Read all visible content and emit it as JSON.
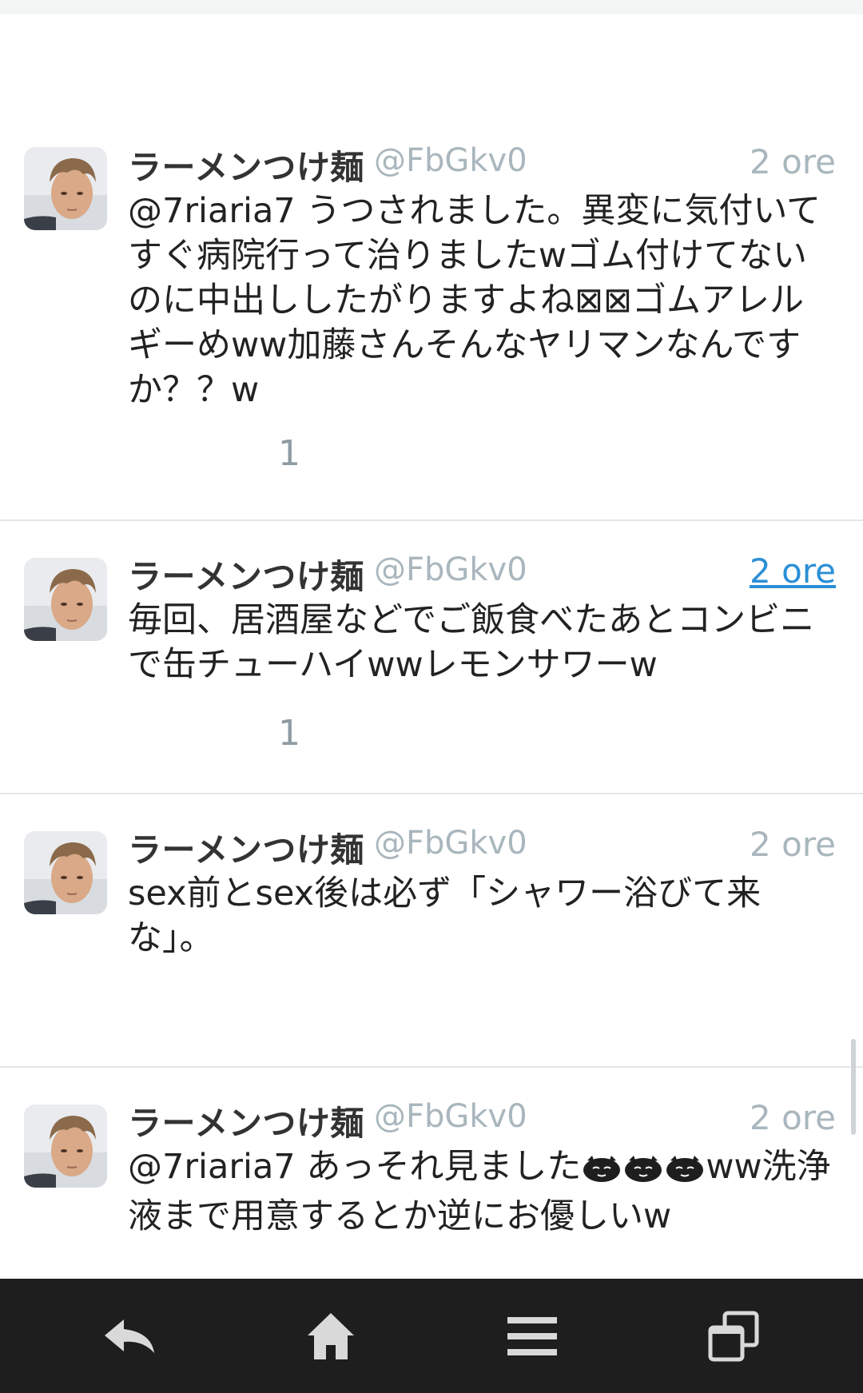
{
  "tweets": [
    {
      "name": "ラーメンつけ麺",
      "handle": "@FbGkv0",
      "time": "2 ore",
      "time_link": false,
      "text": "@7riaria7 うつされました。異変に気付いてすぐ病院行って治りましたwゴム付けてないのに中出ししたがりますよね⊠⊠ゴムアレルギーめww加藤さんそんなヤリマンなんですか？？w",
      "count": "1"
    },
    {
      "name": "ラーメンつけ麺",
      "handle": "@FbGkv0",
      "time": "2 ore",
      "time_link": true,
      "text": "毎回、居酒屋などでご飯食べたあとコンビニで缶チューハイwwレモンサワーw",
      "count": "1"
    },
    {
      "name": "ラーメンつけ麺",
      "handle": "@FbGkv0",
      "time": "2 ore",
      "time_link": false,
      "text": "sex前とsex後は必ず「シャワー浴びて来な」。",
      "count": ""
    },
    {
      "name": "ラーメンつけ麺",
      "handle": "@FbGkv0",
      "time": "2 ore",
      "time_link": false,
      "text_parts": [
        "@7riaria7 あっそれ見ました",
        "ww洗浄液まで用意するとか逆にお優しいw"
      ],
      "emoji_count": 3,
      "count": ""
    }
  ],
  "navbar": {
    "icons": [
      "back-icon",
      "home-icon",
      "menu-icon",
      "recent-apps-icon"
    ]
  },
  "colors": {
    "link": "#2b8fd6",
    "muted": "#a9b6bd",
    "navbar": "#1e1e1e"
  }
}
